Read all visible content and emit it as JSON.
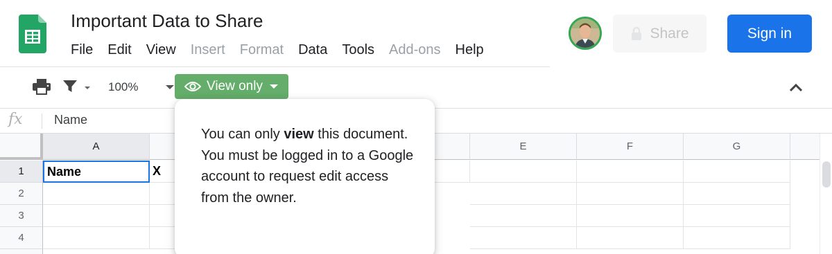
{
  "header": {
    "title": "Important Data to Share",
    "menu": [
      {
        "label": "File",
        "enabled": true
      },
      {
        "label": "Edit",
        "enabled": true
      },
      {
        "label": "View",
        "enabled": true
      },
      {
        "label": "Insert",
        "enabled": false
      },
      {
        "label": "Format",
        "enabled": false
      },
      {
        "label": "Data",
        "enabled": true
      },
      {
        "label": "Tools",
        "enabled": true
      },
      {
        "label": "Add-ons",
        "enabled": false
      },
      {
        "label": "Help",
        "enabled": true
      }
    ],
    "share_label": "Share",
    "signin_label": "Sign in"
  },
  "toolbar": {
    "zoom": "100%",
    "view_only_label": "View only",
    "icons": [
      "print-icon",
      "filter-icon",
      "eye-icon",
      "chevron-up-icon"
    ]
  },
  "formula_bar": {
    "fx_label": "fx",
    "value": "Name"
  },
  "grid": {
    "columns": [
      "A",
      "",
      "",
      "",
      "E",
      "F",
      "G"
    ],
    "rows": [
      "1",
      "2",
      "3",
      "4"
    ],
    "cells": {
      "A1": "Name",
      "B1": "X"
    }
  },
  "tooltip": {
    "prefix": "You can only ",
    "bold": "view",
    "suffix": " this document. You must be logged in to a Google account to request edit access from the owner."
  },
  "colors": {
    "accent_blue": "#1a73e8",
    "view_only_green": "#64ad6a",
    "sheets_green": "#0f9d58"
  }
}
